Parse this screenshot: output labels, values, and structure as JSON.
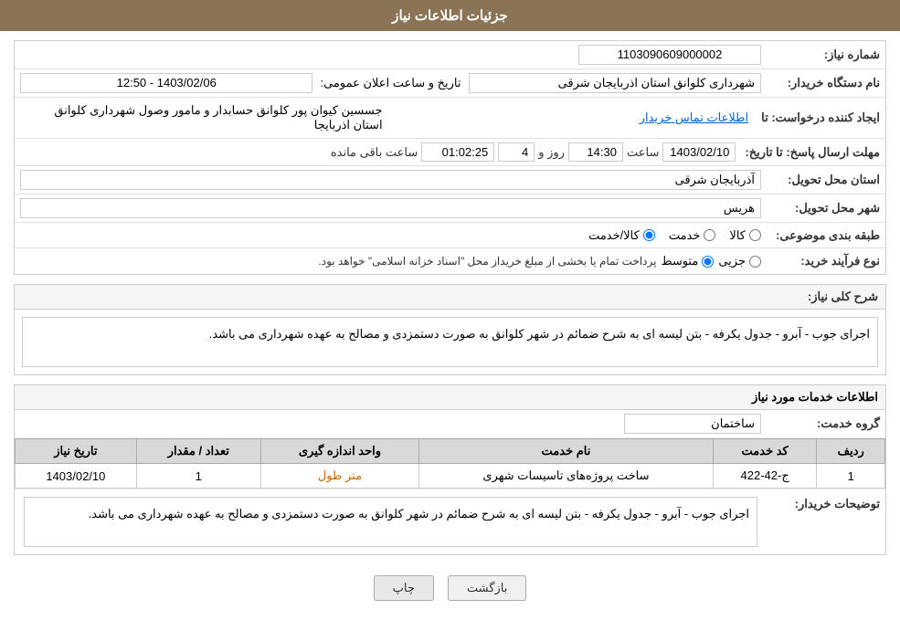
{
  "header": {
    "title": "جزئیات اطلاعات نیاز"
  },
  "form": {
    "request_number_label": "شماره نیاز:",
    "request_number_value": "1103090609000002",
    "org_name_label": "نام دستگاه خریدار:",
    "org_name_value": "شهرداری کلوانق استان اذربایجان شرقی",
    "creator_label": "ایجاد کننده درخواست: تا",
    "creator_value": "جسسین کیوان پور کلوانق حسابدار و مامور وصول شهرداری کلوانق استان اذربایجا",
    "creator_link": "اطلاعات تماس خریدار",
    "date_announce_label": "تاریخ و ساعت اعلان عمومی:",
    "date_announce_value": "1403/02/06 - 12:50",
    "response_deadline_label": "مهلت ارسال پاسخ: تا تاریخ:",
    "response_date": "1403/02/10",
    "response_time_label": "ساعت",
    "response_time": "14:30",
    "response_day_label": "روز و",
    "response_days": "4",
    "remaining_label": "ساعت باقی مانده",
    "remaining_time": "01:02:25",
    "delivery_province_label": "استان محل تحویل:",
    "delivery_province_value": "آذربایجان شرقی",
    "delivery_city_label": "شهر محل تحویل:",
    "delivery_city_value": "هریس",
    "category_label": "طبقه بندی موضوعی:",
    "category_options": [
      "کالا",
      "خدمت",
      "کالا/خدمت"
    ],
    "category_selected": "کالا/خدمت",
    "purchase_type_label": "نوع فرآیند خرید:",
    "purchase_type_options": [
      "جزیی",
      "متوسط"
    ],
    "purchase_type_selected": "متوسط",
    "purchase_type_desc": "پرداخت تمام یا بخشی از مبلغ خریداز محل \"اسناد خزانه اسلامی\" خواهد بود.",
    "description_label": "شرح کلی نیاز:",
    "description_value": "اجرای جوب - آبرو - جدول یکرفه - بتن لیسه ای به شرح ضمائم در شهر کلوانق به صورت دستمزدی و مصالح به عهده شهرداری می باشد.",
    "services_title": "اطلاعات خدمات مورد نیاز",
    "group_label": "گروه خدمت:",
    "group_value": "ساختمان",
    "table": {
      "headers": [
        "ردیف",
        "کد خدمت",
        "نام خدمت",
        "واحد اندازه گیری",
        "تعداد / مقدار",
        "تاریخ نیاز"
      ],
      "rows": [
        {
          "index": "1",
          "code": "ج-42-422",
          "name": "ساخت پروژه‌های تاسیسات شهری",
          "unit": "متر طول",
          "quantity": "1",
          "date": "1403/02/10"
        }
      ]
    },
    "buyer_notes_label": "توضیحات خریدار:",
    "buyer_notes_value": "اجرای جوب - آبرو - جدول یکرفه - بتن لیسه ای به شرح ضمائم در شهر کلوانق به صورت دستمزدی و مصالح به عهده شهرداری می باشد."
  },
  "buttons": {
    "print": "چاپ",
    "back": "بازگشت"
  }
}
